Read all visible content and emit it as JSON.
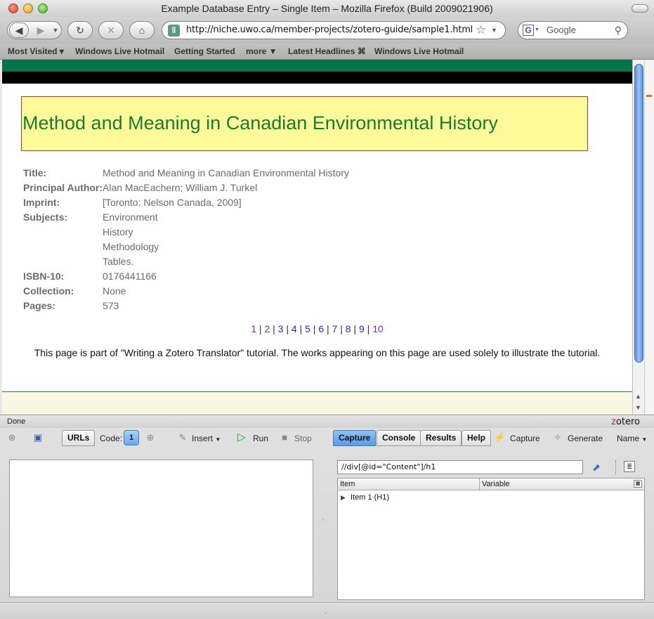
{
  "window": {
    "title": "Example Database Entry – Single Item – Mozilla Firefox (Build 2009021906)"
  },
  "nav": {
    "back_icon": "back-arrow-icon",
    "url": "http://niche.uwo.ca/member-projects/zotero-guide/sample1.html",
    "favicon_glyph": "ǁ",
    "search_placeholder": "Google",
    "search_engine_glyph": "G"
  },
  "bookmarks": [
    {
      "label": "Most Visited ▾"
    },
    {
      "label": "Windows Live Hotmail"
    },
    {
      "label": "Getting Started"
    },
    {
      "label": "more ▼"
    },
    {
      "label": "Latest Headlines ⌘"
    },
    {
      "label": "Windows Live Hotmail"
    }
  ],
  "page": {
    "heading": "Method and Meaning in Canadian Environmental History",
    "fields": [
      {
        "label": "Title:",
        "value": "Method and Meaning in Canadian Environmental History"
      },
      {
        "label": "Principal Author:",
        "value": "Alan MacEachern; William J. Turkel"
      },
      {
        "label": "Imprint:",
        "value": "[Toronto: Nelson Canada, 2009]"
      },
      {
        "label": "Subjects:",
        "value": "Environment"
      },
      {
        "label": "",
        "value": "History"
      },
      {
        "label": "",
        "value": "Methodology"
      },
      {
        "label": "",
        "value": "Tables."
      },
      {
        "label": "ISBN-10:",
        "value": "0176441166"
      },
      {
        "label": "Collection:",
        "value": "None"
      },
      {
        "label": "Pages:",
        "value": "573"
      }
    ],
    "pager": [
      "1",
      "2",
      "3",
      "4",
      "5",
      "6",
      "7",
      "8",
      "9",
      "10"
    ],
    "note": "This page is part of \"Writing a Zotero Translator\" tutorial. The works appearing on this page are used solely to illustrate the tutorial."
  },
  "status": {
    "text": "Done",
    "logo_z": "z",
    "logo_rest": "otero"
  },
  "scaffold": {
    "urls_tab": "URLs",
    "code_label": "Code:",
    "code_count": "1",
    "insert_label": "Insert",
    "run_label": "Run",
    "stop_label": "Stop",
    "tabs": [
      "Capture",
      "Console",
      "Results",
      "Help"
    ],
    "capture_label": "Capture",
    "generate_label": "Generate",
    "name_label": "Name",
    "xpath": "//div[@id=\"Content\"]/h1",
    "col_item": "Item",
    "col_variable": "Variable",
    "tree_row": "Item 1 (H1)"
  }
}
